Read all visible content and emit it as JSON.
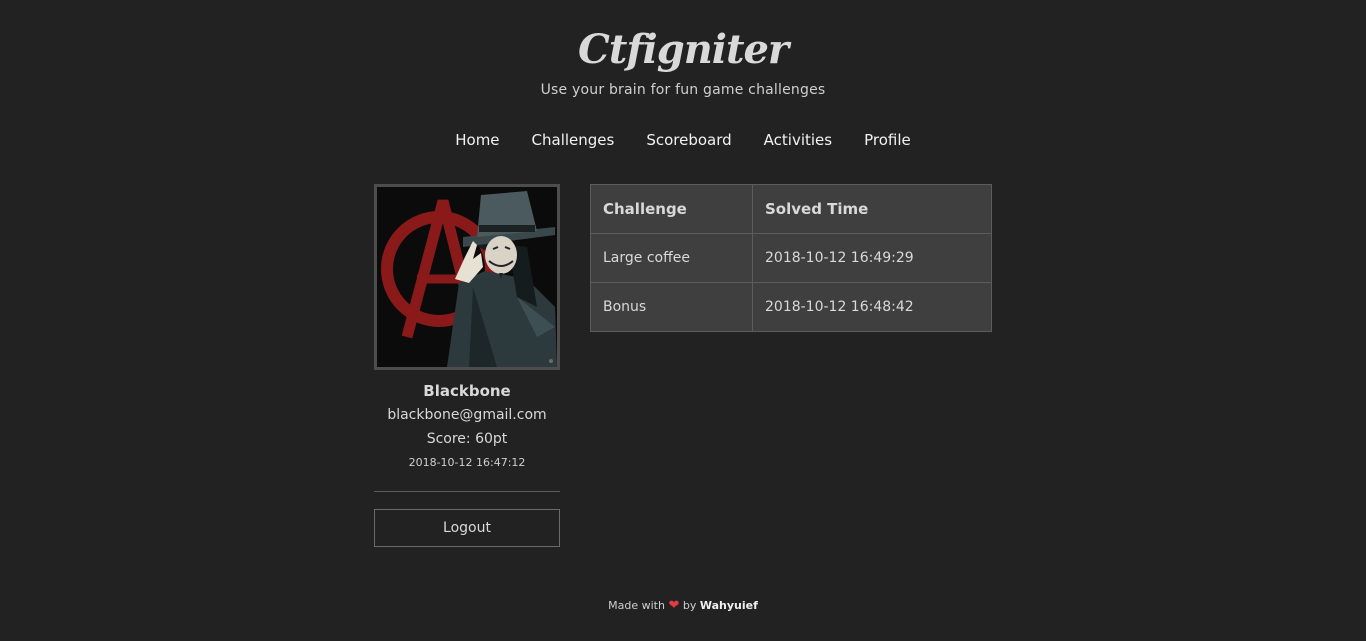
{
  "site": {
    "brand": "Ctfigniter",
    "tagline": "Use your brain for fun game challenges"
  },
  "nav": {
    "items": [
      {
        "label": "Home"
      },
      {
        "label": "Challenges"
      },
      {
        "label": "Scoreboard"
      },
      {
        "label": "Activities"
      },
      {
        "label": "Profile"
      }
    ]
  },
  "profile": {
    "name": "Blackbone",
    "email": "blackbone@gmail.com",
    "score": "Score: 60pt",
    "joined": "2018-10-12 16:47:12",
    "logout_label": "Logout"
  },
  "solved": {
    "headers": [
      "Challenge",
      "Solved Time"
    ],
    "rows": [
      {
        "challenge": "Large coffee",
        "time": "2018-10-12 16:49:29"
      },
      {
        "challenge": "Bonus",
        "time": "2018-10-12 16:48:42"
      }
    ]
  },
  "footer": {
    "prefix": "Made with",
    "heart": "❤",
    "by": "by",
    "author": "Wahyuief"
  },
  "colors": {
    "background": "#222222",
    "table_bg": "#3f3f3f",
    "heart": "#e23b45"
  }
}
